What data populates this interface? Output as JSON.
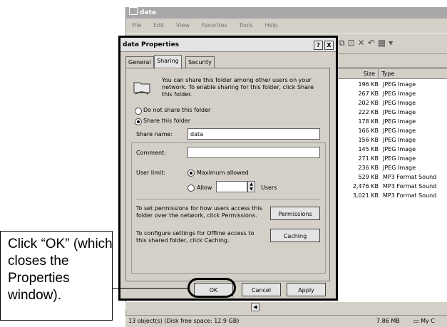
{
  "explorer": {
    "title": "data",
    "menu": [
      "File",
      "Edit",
      "View",
      "Favorites",
      "Tools",
      "Help"
    ],
    "columns": {
      "size": "Size",
      "type": "Type"
    },
    "files": [
      {
        "size": "196 KB",
        "type": "JPEG Image"
      },
      {
        "size": "267 KB",
        "type": "JPEG Image"
      },
      {
        "size": "202 KB",
        "type": "JPEG Image"
      },
      {
        "size": "222 KB",
        "type": "JPEG Image"
      },
      {
        "size": "178 KB",
        "type": "JPEG Image"
      },
      {
        "size": "166 KB",
        "type": "JPEG Image"
      },
      {
        "size": "156 KB",
        "type": "JPEG Image"
      },
      {
        "size": "145 KB",
        "type": "JPEG Image"
      },
      {
        "size": "271 KB",
        "type": "JPEG Image"
      },
      {
        "size": "236 KB",
        "type": "JPEG Image"
      },
      {
        "size": "529 KB",
        "type": "MP3 Format Sound"
      },
      {
        "size": "2,476 KB",
        "type": "MP3 Format Sound"
      },
      {
        "size": "3,021 KB",
        "type": "MP3 Format Sound"
      }
    ],
    "status_left": "13 object(s) (Disk free space: 12.9 GB)",
    "status_size": "7.86 MB",
    "status_right": "My C"
  },
  "dialog": {
    "title": "data Properties",
    "help_glyph": "?",
    "close_glyph": "X",
    "tabs": [
      "General",
      "Sharing",
      "Security"
    ],
    "active_tab": "Sharing",
    "intro": "You can share this folder among other users on your network. To enable sharing for this folder, click Share this folder.",
    "radio_no_share": "Do not share this folder",
    "radio_share": "Share this folder",
    "share_name_label": "Share name:",
    "share_name_value": "data",
    "comment_label": "Comment:",
    "comment_value": "",
    "user_limit_label": "User limit:",
    "max_allowed": "Maximum allowed",
    "allow": "Allow",
    "users": "Users",
    "permissions_text": "To set permissions for how users access this folder over the network, click Permissions.",
    "permissions_button": "Permissions",
    "caching_text": "To configure settings for Offline access to this shared folder, click Caching.",
    "caching_button": "Caching",
    "ok": "OK",
    "cancel": "Cancel",
    "apply": "Apply"
  },
  "callout": {
    "text": "Click “OK” (which closes the Properties window)."
  }
}
